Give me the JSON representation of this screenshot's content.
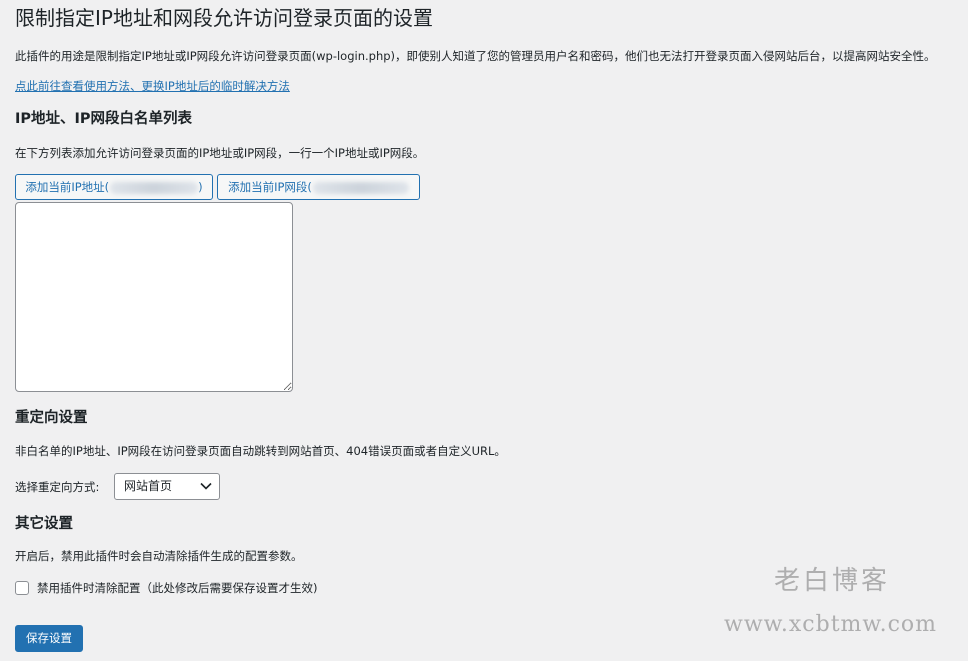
{
  "page": {
    "title": "限制指定IP地址和网段允许访问登录页面的设置",
    "description": "此插件的用途是限制指定IP地址或IP网段允许访问登录页面(wp-login.php)，即使别人知道了您的管理员用户名和密码，他们也无法打开登录页面入侵网站后台，以提高网站安全性。",
    "help_link": "点此前往查看使用方法、更换IP地址后的临时解决方法"
  },
  "whitelist": {
    "heading": "IP地址、IP网段白名单列表",
    "description": "在下方列表添加允许访问登录页面的IP地址或IP网段，一行一个IP地址或IP网段。",
    "add_ip_button": "添加当前IP地址(",
    "add_ip_button_end": ")",
    "add_range_button": "添加当前IP网段(",
    "textarea_value": ""
  },
  "redirect": {
    "heading": "重定向设置",
    "description": "非白名单的IP地址、IP网段在访问登录页面自动跳转到网站首页、404错误页面或者自定义URL。",
    "select_label": "选择重定向方式:",
    "selected_option": "网站首页"
  },
  "other": {
    "heading": "其它设置",
    "description": "开启后，禁用此插件时会自动清除插件生成的配置参数。",
    "checkbox_label": "禁用插件时清除配置（此处修改后需要保存设置才生效)",
    "checkbox_checked": false
  },
  "save_button": "保存设置",
  "watermark": {
    "name": "老白博客",
    "url": "www.xcbtmw.com"
  },
  "colors": {
    "accent": "#2271b1",
    "background": "#f0f0f1",
    "text": "#1d2327"
  }
}
